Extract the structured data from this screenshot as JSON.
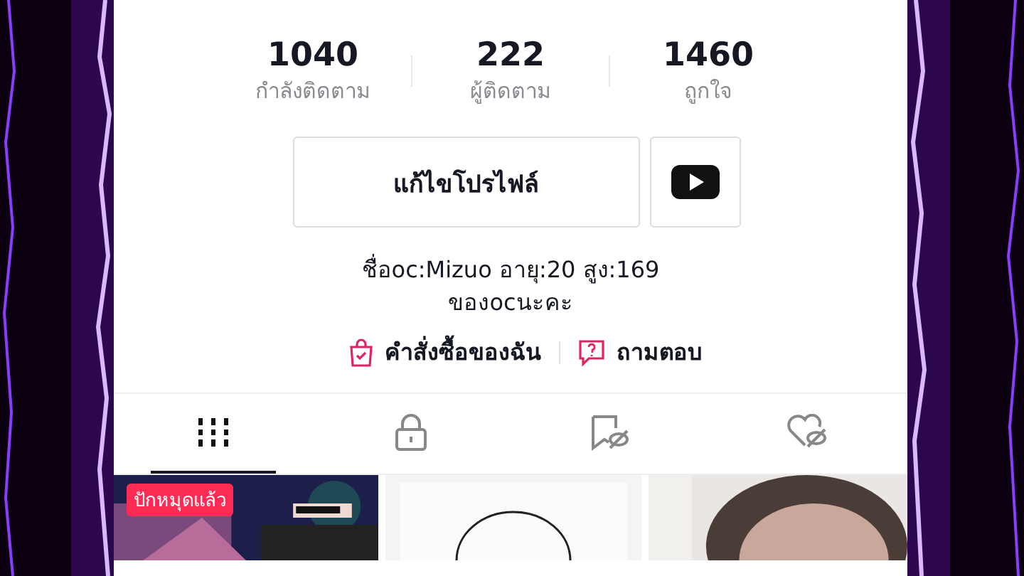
{
  "stats": [
    {
      "value": "1040",
      "label": "กำลังติดตาม"
    },
    {
      "value": "222",
      "label": "ผู้ติดตาม"
    },
    {
      "value": "1460",
      "label": "ถูกใจ"
    }
  ],
  "edit_button": "แก้ไขโปรไฟล์",
  "bio": [
    "ชื่อoc:Mizuo อายุ:20 สูง:169",
    "ของocนะคะ"
  ],
  "links": [
    {
      "kind": "orders",
      "label": "คำสั่งซื้อของฉัน"
    },
    {
      "kind": "qa",
      "label": "ถามตอบ"
    }
  ],
  "tabs": [
    {
      "kind": "videos",
      "selected": true
    },
    {
      "kind": "private",
      "selected": false
    },
    {
      "kind": "saved",
      "selected": false
    },
    {
      "kind": "liked",
      "selected": false
    }
  ],
  "videos": [
    {
      "kind": "picture",
      "pinned_label": "ปักหมุดแล้ว"
    },
    {
      "kind": "picture"
    },
    {
      "kind": "picture"
    }
  ]
}
